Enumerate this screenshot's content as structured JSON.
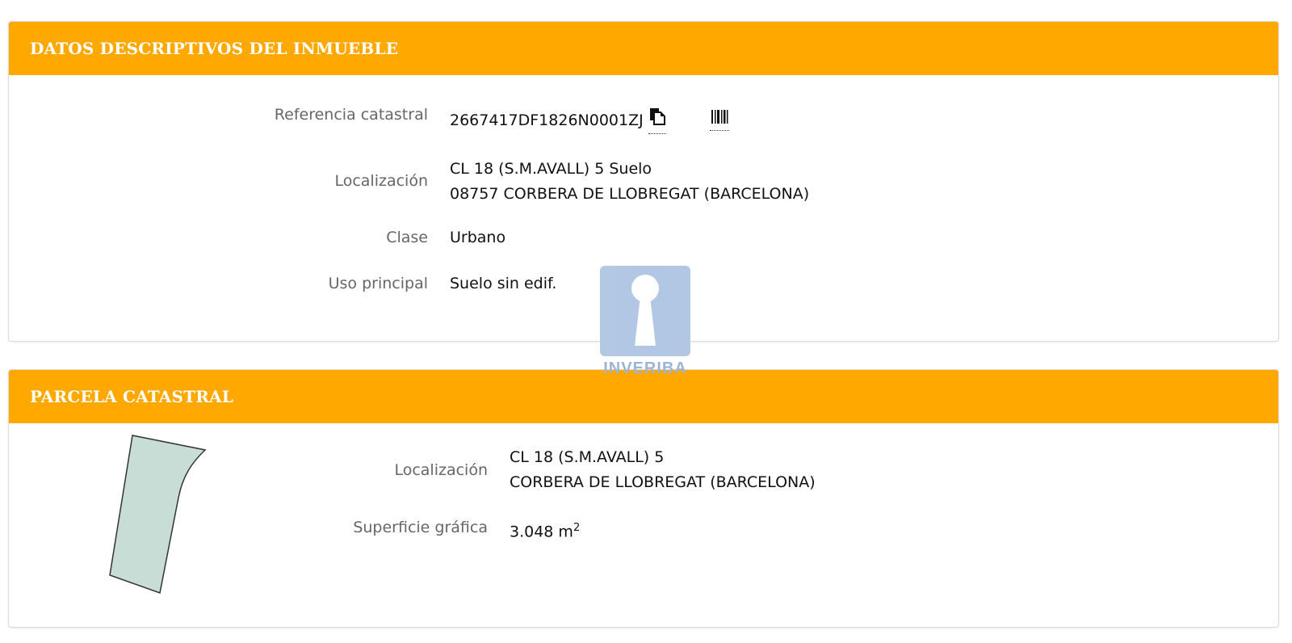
{
  "panel1": {
    "title": "DATOS DESCRIPTIVOS DEL INMUEBLE",
    "referencia_label": "Referencia catastral",
    "referencia_value": "2667417DF1826N0001ZJ",
    "copy_icon": "copy-icon",
    "barcode_icon": "barcode-icon",
    "localizacion_label": "Localización",
    "localizacion_line1": "CL 18 (S.M.AVALL) 5 Suelo",
    "localizacion_line2": "08757 CORBERA DE LLOBREGAT (BARCELONA)",
    "clase_label": "Clase",
    "clase_value": "Urbano",
    "uso_label": "Uso principal",
    "uso_value": "Suelo sin edif."
  },
  "panel2": {
    "title": "PARCELA CATASTRAL",
    "localizacion_label": "Localización",
    "localizacion_line1": "CL 18 (S.M.AVALL) 5",
    "localizacion_line2": "CORBERA DE LLOBREGAT (BARCELONA)",
    "superficie_label": "Superficie gráfica",
    "superficie_value": "3.048 m",
    "superficie_unit_exp": "2"
  },
  "watermark": {
    "text": "INVERIBA",
    "icon": "keyhole-icon"
  },
  "colors": {
    "header": "#FFA800",
    "parcel_fill": "#c8ddd6"
  }
}
